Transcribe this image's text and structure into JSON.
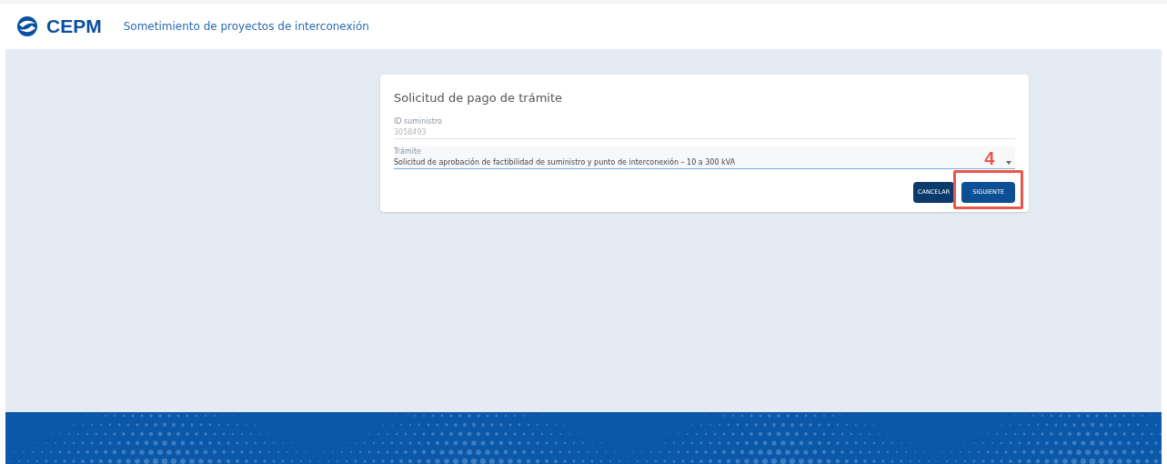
{
  "header": {
    "brand": "CEPM",
    "title": "Sometimiento de proyectos de interconexión"
  },
  "card": {
    "title": "Solicitud de pago de trámite",
    "fields": [
      {
        "kind": "text",
        "label": "ID suministro",
        "value": "3058493"
      },
      {
        "kind": "select",
        "label": "Trámite",
        "value": "Solicitud de aprobación de factibilidad de suministro y punto de interconexión – 10 a 300 kVA"
      }
    ],
    "buttons": [
      {
        "label": "CANCELAR",
        "highlighted": false
      },
      {
        "label": "SIGUIENTE",
        "highlighted": true
      }
    ]
  },
  "annotation": {
    "label": "4"
  }
}
